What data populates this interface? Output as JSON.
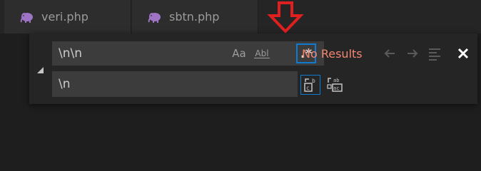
{
  "tabs": [
    {
      "label": "veri.php",
      "icon": "php-elephant-icon"
    },
    {
      "label": "sbtn.php",
      "icon": "php-elephant-icon"
    }
  ],
  "annotation": {
    "icon": "red-down-arrow-icon",
    "color": "#e02020"
  },
  "find": {
    "value": "\\n\\n",
    "options": {
      "match_case_label": "Aa",
      "whole_word_label": "Abl",
      "regex_label": ".*",
      "regex_active": true
    },
    "status": "No Results",
    "status_color": "#f48771"
  },
  "replace": {
    "value": "\\n"
  },
  "colors": {
    "accent": "#0e7bd0",
    "background": "#1e1e1e",
    "widget": "#252526",
    "input": "#3c3c3c"
  }
}
